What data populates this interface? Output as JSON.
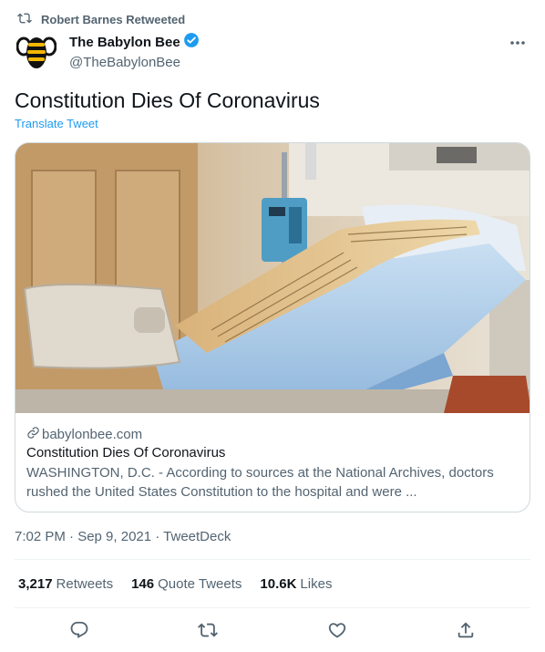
{
  "retweet_context": {
    "text": "Robert Barnes Retweeted",
    "icon": "retweet-icon"
  },
  "author": {
    "display_name": "The Babylon Bee",
    "handle": "@TheBabylonBee",
    "verified": true,
    "avatar_icon": "bee-logo-icon"
  },
  "tweet": {
    "text": "Constitution Dies Of Coronavirus",
    "translate_label": "Translate Tweet"
  },
  "card": {
    "image_icon": "hospital-bed-constitution-image",
    "domain": "babylonbee.com",
    "title": "Constitution Dies Of Coronavirus",
    "description": "WASHINGTON, D.C. - According to sources at the National Archives, doctors rushed the United States Constitution to the hospital and were ..."
  },
  "meta": {
    "text": "7:02 PM · Sep 9, 2021 · TweetDeck"
  },
  "stats": {
    "retweets_count": "3,217",
    "retweets_label": "Retweets",
    "quotes_count": "146",
    "quotes_label": "Quote Tweets",
    "likes_count": "10.6K",
    "likes_label": "Likes"
  },
  "actions": [
    "reply-icon",
    "retweet-icon",
    "like-icon",
    "share-icon"
  ],
  "colors": {
    "accent": "#1d9bf0",
    "text": "#0f1419",
    "secondary": "#536471",
    "border": "#cfd9de"
  }
}
